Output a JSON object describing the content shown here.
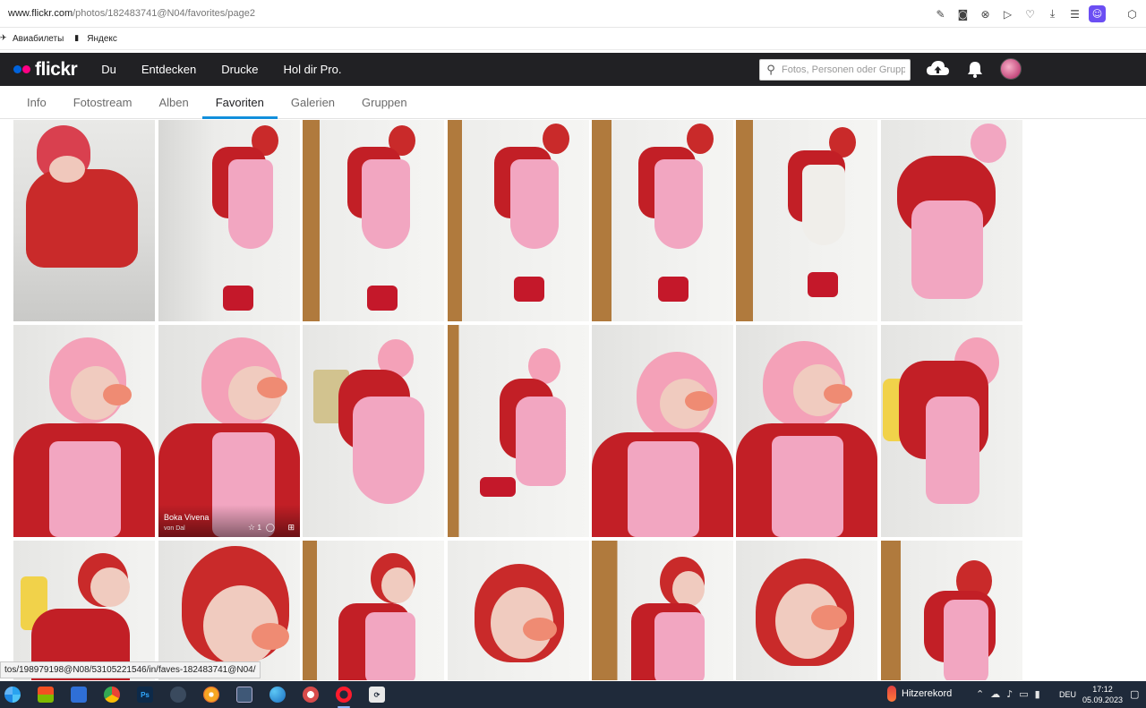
{
  "browser": {
    "url_host": "www.flickr.com",
    "url_path": "/photos/182483741@N04/favorites/page2",
    "toolbar_icons": [
      "edit-icon",
      "camera-icon",
      "circle-icon",
      "play-icon",
      "heart-icon",
      "download-icon",
      "menu-icon",
      "profile-icon",
      "cube-icon"
    ],
    "bookmarks": [
      {
        "label": "Авиабилеты",
        "icon": "plane-icon"
      },
      {
        "label": "Яндекс",
        "icon": "doc-icon"
      }
    ]
  },
  "flickr": {
    "logo_text": "flickr",
    "brand_colors": {
      "blue": "#0063dc",
      "pink": "#ff0084",
      "header_bg": "#212124",
      "accent": "#128fdc"
    },
    "nav": [
      "Du",
      "Entdecken",
      "Drucke",
      "Hol dir Pro."
    ],
    "search_placeholder": "Fotos, Personen oder Gruppen",
    "subnav": [
      {
        "label": "Info",
        "active": false
      },
      {
        "label": "Fotostream",
        "active": false
      },
      {
        "label": "Alben",
        "active": false
      },
      {
        "label": "Favoriten",
        "active": true
      },
      {
        "label": "Galerien",
        "active": false
      },
      {
        "label": "Gruppen",
        "active": false
      }
    ]
  },
  "hover_overlay": {
    "author": "Boka Vivena",
    "sub": "von Dal",
    "fav_count": "1",
    "close": "×"
  },
  "status_link": "tos/198979198@N08/53105221546/in/faves-182483741@N04/",
  "taskbar": {
    "apps": [
      "windows-start",
      "edge",
      "store",
      "mail",
      "chrome",
      "photoshop",
      "camera",
      "browser-yellow",
      "system-settings",
      "edge-dev",
      "sharex",
      "opera",
      "remote"
    ],
    "weather_label": "Hitzerekord",
    "language": "DEU",
    "time": "17:12",
    "date": "05.09.2023"
  }
}
